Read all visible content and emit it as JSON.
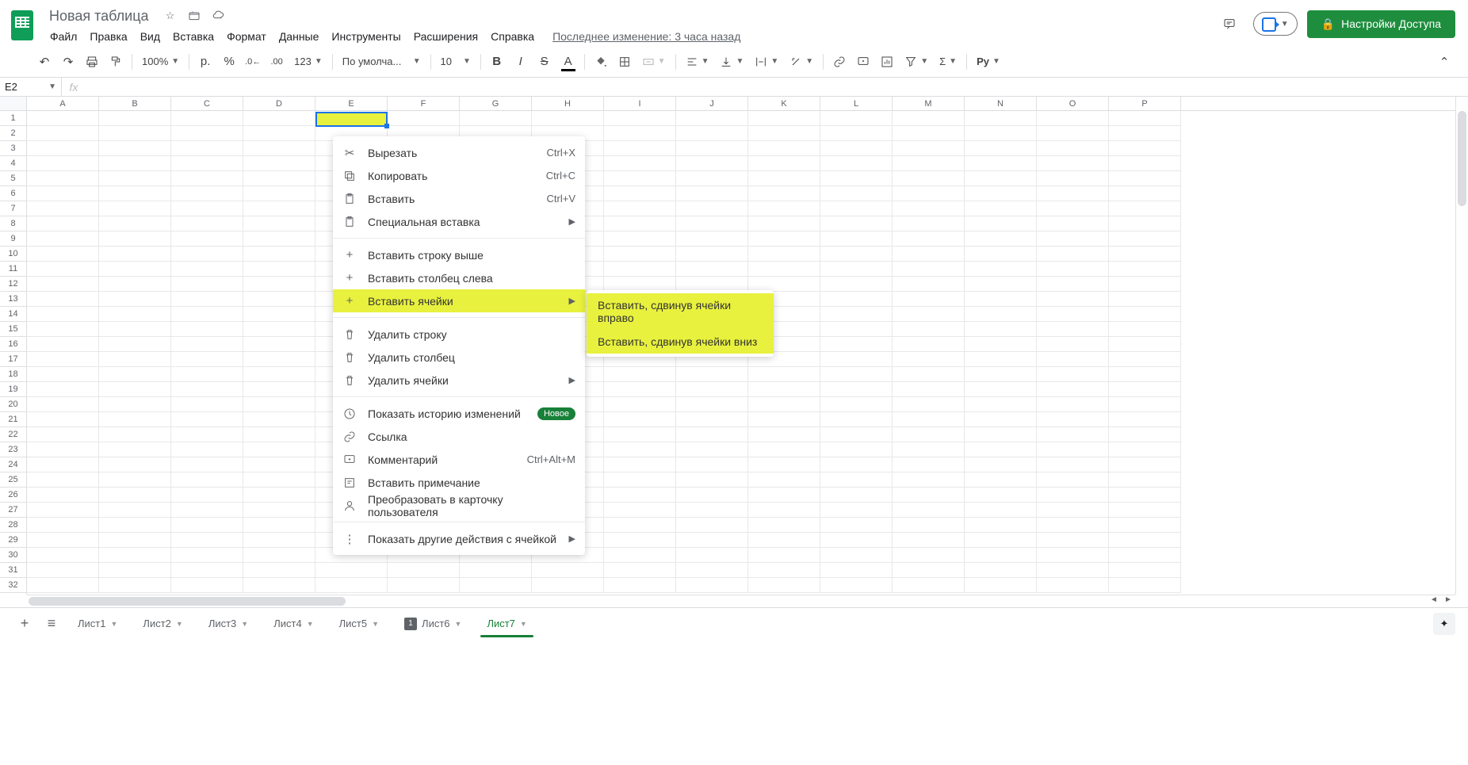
{
  "doc": {
    "title": "Новая таблица"
  },
  "menubar": {
    "file": "Файл",
    "edit": "Правка",
    "view": "Вид",
    "insert": "Вставка",
    "format": "Формат",
    "data": "Данные",
    "tools": "Инструменты",
    "extensions": "Расширения",
    "help": "Справка",
    "last_edit": "Последнее изменение: 3 часа назад"
  },
  "share": {
    "label": "Настройки Доступа"
  },
  "toolbar": {
    "zoom": "100%",
    "currency": "р.",
    "percent": "%",
    "dec_dec": ".0",
    "inc_dec": ".00",
    "num_fmt": "123",
    "font": "По умолча...",
    "size": "10",
    "py": "Py"
  },
  "namebox": {
    "value": "E2"
  },
  "columns": [
    "A",
    "B",
    "C",
    "D",
    "E",
    "F",
    "G",
    "H",
    "I",
    "J",
    "K",
    "L",
    "M",
    "N",
    "O",
    "P"
  ],
  "rows": [
    "1",
    "2",
    "3",
    "4",
    "5",
    "6",
    "7",
    "8",
    "9",
    "10",
    "11",
    "12",
    "13",
    "14",
    "15",
    "16",
    "17",
    "18",
    "19",
    "20",
    "21",
    "22",
    "23",
    "24",
    "25",
    "26",
    "27",
    "28",
    "29",
    "30",
    "31",
    "32"
  ],
  "context_menu": {
    "cut": {
      "label": "Вырезать",
      "shortcut": "Ctrl+X"
    },
    "copy": {
      "label": "Копировать",
      "shortcut": "Ctrl+C"
    },
    "paste": {
      "label": "Вставить",
      "shortcut": "Ctrl+V"
    },
    "paste_special": {
      "label": "Специальная вставка"
    },
    "insert_row": {
      "label": "Вставить строку выше"
    },
    "insert_col": {
      "label": "Вставить столбец слева"
    },
    "insert_cells": {
      "label": "Вставить ячейки"
    },
    "delete_row": {
      "label": "Удалить строку"
    },
    "delete_col": {
      "label": "Удалить столбец"
    },
    "delete_cells": {
      "label": "Удалить ячейки"
    },
    "history": {
      "label": "Показать историю изменений",
      "badge": "Новое"
    },
    "link": {
      "label": "Ссылка"
    },
    "comment": {
      "label": "Комментарий",
      "shortcut": "Ctrl+Alt+M"
    },
    "note": {
      "label": "Вставить примечание"
    },
    "people": {
      "label": "Преобразовать в карточку пользователя"
    },
    "more": {
      "label": "Показать другие действия с ячейкой"
    }
  },
  "submenu": {
    "shift_right": "Вставить, сдвинув ячейки вправо",
    "shift_down": "Вставить, сдвинув ячейки вниз"
  },
  "sheets": [
    {
      "name": "Лист1"
    },
    {
      "name": "Лист2"
    },
    {
      "name": "Лист3"
    },
    {
      "name": "Лист4"
    },
    {
      "name": "Лист5"
    },
    {
      "name": "Лист6",
      "badge": "1"
    },
    {
      "name": "Лист7",
      "active": true
    }
  ]
}
